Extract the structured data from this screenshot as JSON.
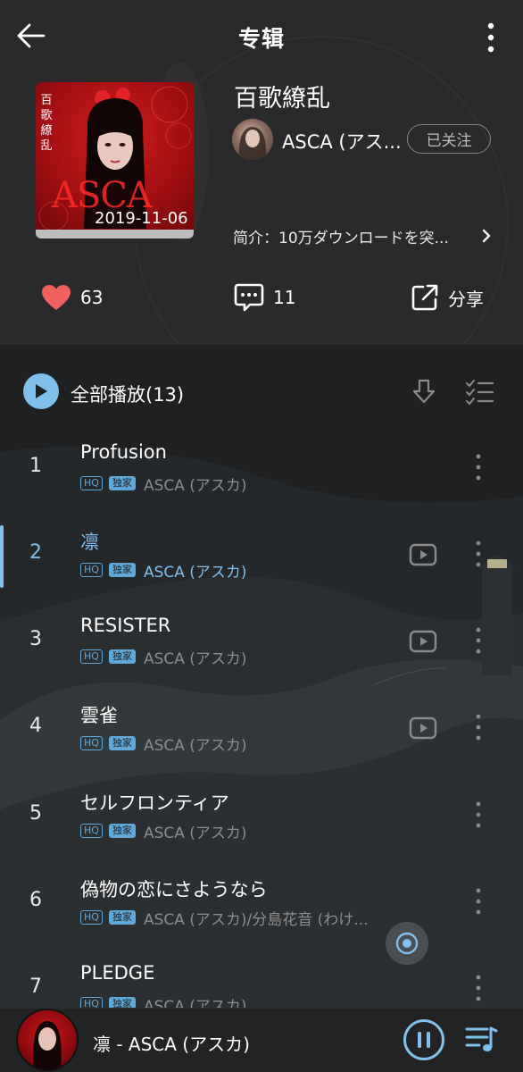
{
  "header": {
    "title": "专辑"
  },
  "album": {
    "title": "百歌繚乱",
    "cover_kanji": "百\n歌\n繚\n乱",
    "cover_logo": "ASCA",
    "release_date": "2019-11-06",
    "artist": "ASCA (アス...",
    "follow_label": "已关注",
    "intro": "简介：10万ダウンロードを突..."
  },
  "actions": {
    "likes": "63",
    "comments": "11",
    "share_label": "分享"
  },
  "list": {
    "play_all_label": "全部播放(13)",
    "tracks": [
      {
        "num": "1",
        "name": "Profusion",
        "badges": [
          "HQ",
          "独家"
        ],
        "artist": "ASCA (アスカ)",
        "has_mv": false,
        "active": false
      },
      {
        "num": "2",
        "name": "凛",
        "badges": [
          "HQ",
          "独家"
        ],
        "artist": "ASCA (アスカ)",
        "has_mv": true,
        "active": true
      },
      {
        "num": "3",
        "name": "RESISTER",
        "badges": [
          "HQ",
          "独家"
        ],
        "artist": "ASCA (アスカ)",
        "has_mv": true,
        "active": false
      },
      {
        "num": "4",
        "name": "雲雀",
        "badges": [
          "HQ",
          "独家"
        ],
        "artist": "ASCA (アスカ)",
        "has_mv": true,
        "active": false
      },
      {
        "num": "5",
        "name": "セルフロンティア",
        "badges": [
          "HQ",
          "独家"
        ],
        "artist": "ASCA (アスカ)",
        "has_mv": false,
        "active": false
      },
      {
        "num": "6",
        "name": "偽物の恋にさようなら",
        "badges": [
          "HQ",
          "独家"
        ],
        "artist": "ASCA (アスカ)/分島花音 (わけ...",
        "has_mv": false,
        "active": false
      },
      {
        "num": "7",
        "name": "PLEDGE",
        "badges": [
          "HQ",
          "独家"
        ],
        "artist": "ASCA (アスカ)",
        "has_mv": false,
        "active": false
      }
    ]
  },
  "player": {
    "now_playing": "凛 - ASCA (アスカ)"
  },
  "colors": {
    "accent": "#7fc1ec",
    "like": "#f0605e",
    "background": "#1e1f21"
  },
  "icons": {
    "back": "arrow-left-icon",
    "more": "more-vertical-icon",
    "like": "heart-icon",
    "comment": "comment-icon",
    "share": "share-icon",
    "play": "play-icon",
    "download": "download-icon",
    "multi_select": "checklist-icon",
    "mv": "video-icon",
    "pause": "pause-icon",
    "queue": "playlist-icon"
  }
}
